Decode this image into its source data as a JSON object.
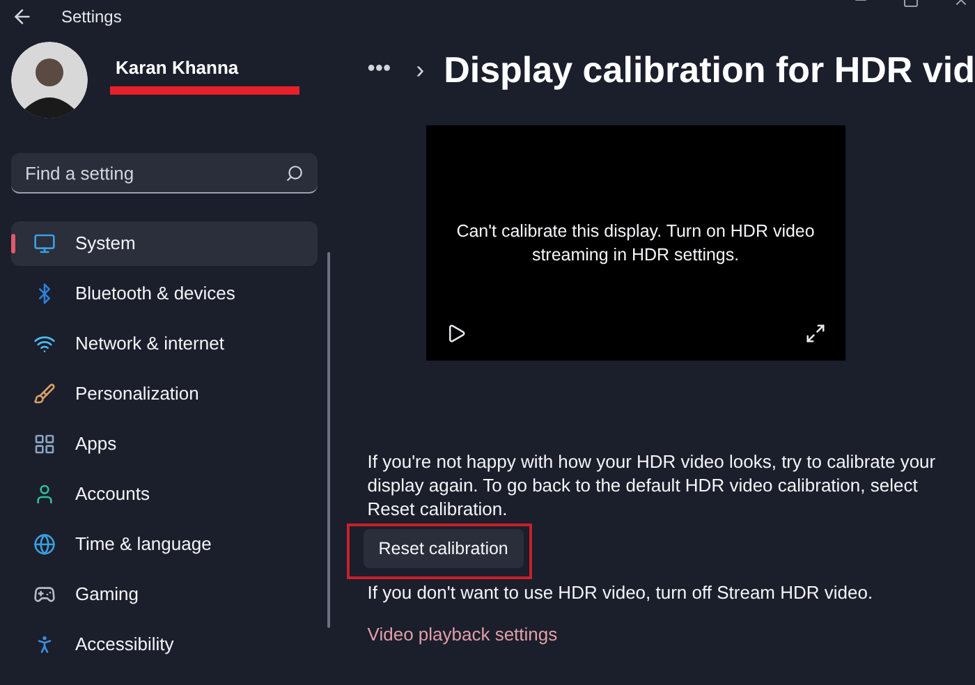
{
  "window": {
    "title": "Settings"
  },
  "profile": {
    "name": "Karan Khanna",
    "redacted": true
  },
  "search": {
    "placeholder": "Find a setting"
  },
  "sidebar": {
    "items": [
      {
        "label": "System",
        "selected": true
      },
      {
        "label": "Bluetooth & devices",
        "selected": false
      },
      {
        "label": "Network & internet",
        "selected": false
      },
      {
        "label": "Personalization",
        "selected": false
      },
      {
        "label": "Apps",
        "selected": false
      },
      {
        "label": "Accounts",
        "selected": false
      },
      {
        "label": "Time & language",
        "selected": false
      },
      {
        "label": "Gaming",
        "selected": false
      },
      {
        "label": "Accessibility",
        "selected": false
      }
    ]
  },
  "breadcrumb": {
    "overflow": "•••",
    "separator": "›",
    "title": "Display calibration for HDR vid"
  },
  "video": {
    "message": "Can't calibrate this display. Turn on HDR video streaming in HDR settings."
  },
  "description": "If you're not happy with how your HDR video looks, try to calibrate your display again. To go back to the default HDR video calibration, select Reset calibration.",
  "reset_button": {
    "label": "Reset calibration",
    "highlighted": true
  },
  "note": "If you don't want to use HDR video, turn off Stream HDR video.",
  "link": "Video playback settings"
}
